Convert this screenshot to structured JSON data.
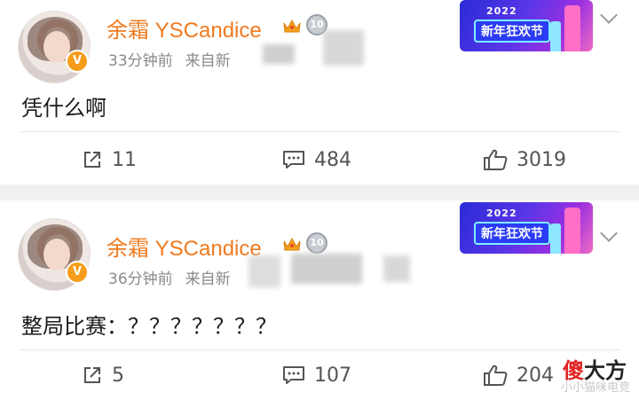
{
  "posts": [
    {
      "user_name": "余霜 YSCandice",
      "time": "33分钟前",
      "source": "来自新",
      "verified_badge": "V",
      "medal": "10",
      "banner": {
        "year": "2022",
        "title": "新年狂欢节"
      },
      "text": "凭什么啊",
      "actions": {
        "share": "11",
        "comment": "484",
        "like": "3019"
      }
    },
    {
      "user_name": "余霜 YSCandice",
      "time": "36分钟前",
      "source": "来自新",
      "verified_badge": "V",
      "medal": "10",
      "banner": {
        "year": "2022",
        "title": "新年狂欢节"
      },
      "text": "整局比赛：？？？？？？？",
      "actions": {
        "share": "5",
        "comment": "107",
        "like": "204"
      }
    }
  ],
  "watermark": {
    "red": "傻",
    "black": "大方",
    "sub": "小小猫咪电竞"
  },
  "icons": {
    "share": "share-icon",
    "comment": "comment-icon",
    "like": "thumbs-up-icon",
    "menu": "chevron-down-icon",
    "crown": "crown-icon"
  },
  "colors": {
    "name": "#f07a1f",
    "meta": "#8a8a8a",
    "badge": "#f59c1a"
  }
}
